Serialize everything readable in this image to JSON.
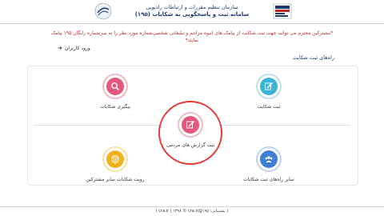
{
  "header": {
    "org_title": "سازمان تنظیم مقررات و ارتباطات رادیویی",
    "sys_title": "سامانه ثبت و پاسخگویی به شکایات (۱۹۵)"
  },
  "notice": "*مشترکین محترم می توانند جهت ثبت شکایت از پیامک های انبوه مزاحم و تبلیغاتی شخصی‌شماره مورد نظر را به سرشماره رایگان ۱۹۵ پیامک نمایند*",
  "login": {
    "label": "ورود کاربران"
  },
  "section_title": "راه‌های ثبت شکایت",
  "items": [
    {
      "label": "پیگیری شکایات",
      "icon": "search-icon",
      "color": "#e4577f"
    },
    {
      "label": "ثبت شکایت",
      "icon": "edit-icon",
      "color": "#39b5d8"
    },
    {
      "label": "ثبت گزارش های مردمی",
      "icon": "edit-icon",
      "color": "#e4577f"
    },
    {
      "label": "رویت شکایات سایر مشترکین",
      "icon": "target-icon",
      "color": "#f2b21c"
    },
    {
      "label": "سایر راه‌های ثبت شکایات",
      "icon": "users-icon",
      "color": "#3f7fd9"
    }
  ],
  "colors": {
    "brand": "#1f3b70",
    "notice": "#c62828",
    "highlight": "#e53935"
  },
  "footer": "( پشتیبانی: ۱۹۵@cra.ir | ۱۳۹۸ © cra.ir )"
}
